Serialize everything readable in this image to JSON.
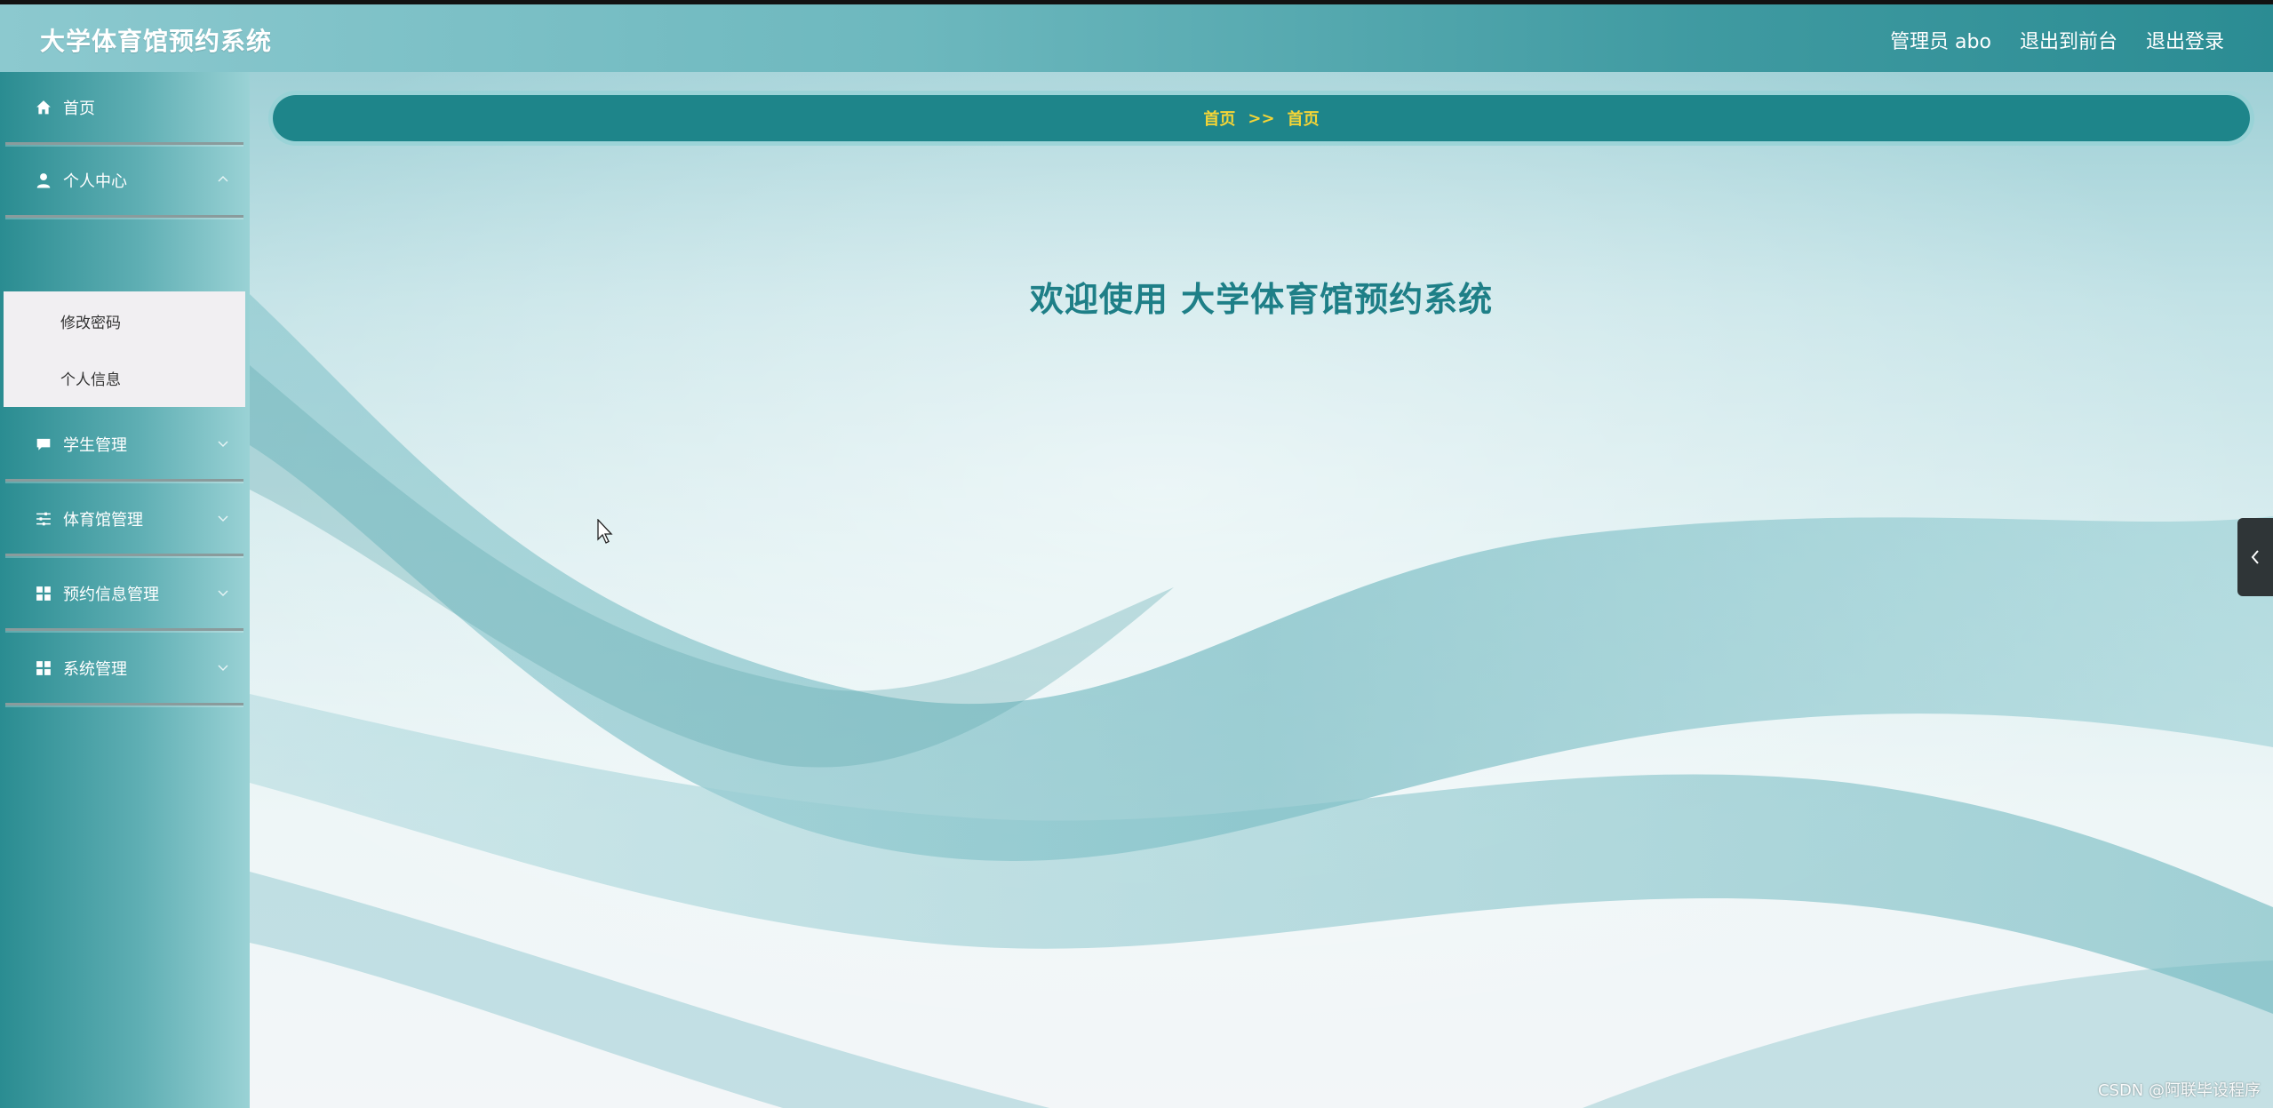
{
  "header": {
    "title": "大学体育馆预约系统",
    "user": "管理员 abo",
    "back_to_front": "退出到前台",
    "logout": "退出登录"
  },
  "sidebar": {
    "items": [
      {
        "label": "首页",
        "icon": "home-icon"
      },
      {
        "label": "个人中心",
        "icon": "user-icon",
        "expanded": true,
        "children": [
          {
            "label": "修改密码"
          },
          {
            "label": "个人信息"
          }
        ]
      },
      {
        "label": "学生管理",
        "icon": "chat-icon"
      },
      {
        "label": "体育馆管理",
        "icon": "sliders-icon"
      },
      {
        "label": "预约信息管理",
        "icon": "grid-icon"
      },
      {
        "label": "系统管理",
        "icon": "grid-icon"
      }
    ]
  },
  "breadcrumb": {
    "items": [
      "首页",
      "首页"
    ],
    "separator": ">>"
  },
  "main": {
    "welcome": "欢迎使用 大学体育馆预约系统"
  },
  "watermark": "CSDN @阿联毕设程序",
  "colors": {
    "accent": "#1e858a",
    "breadcrumb_text": "#f5d536",
    "welcome_text": "#1e7f87"
  }
}
